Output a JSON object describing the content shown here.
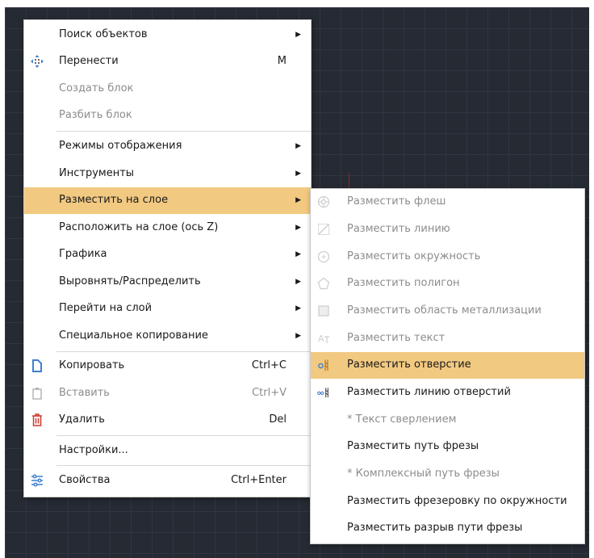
{
  "main_menu": {
    "items": [
      {
        "label": "Поиск объектов",
        "shortcut": "",
        "arrow": "▶"
      },
      {
        "label": "Перенести",
        "shortcut": "M",
        "icon": "move-icon"
      },
      {
        "label": "Создать блок",
        "shortcut": ""
      },
      {
        "label": "Разбить блок",
        "shortcut": ""
      },
      {
        "label": "Режимы отображения",
        "arrow": "▶"
      },
      {
        "label": "Инструменты",
        "arrow": "▶"
      },
      {
        "label": "Разместить на слое",
        "arrow": "▶"
      },
      {
        "label": "Расположить на слое (ось Z)",
        "arrow": "▶"
      },
      {
        "label": "Графика",
        "arrow": "▶"
      },
      {
        "label": "Выровнять/Распределить",
        "arrow": "▶"
      },
      {
        "label": "Перейти на слой",
        "arrow": "▶"
      },
      {
        "label": "Специальное копирование",
        "arrow": "▶"
      },
      {
        "label": "Копировать",
        "shortcut": "Ctrl+C",
        "icon": "copy-icon"
      },
      {
        "label": "Вставить",
        "shortcut": "Ctrl+V",
        "icon": "paste-icon"
      },
      {
        "label": "Удалить",
        "shortcut": "Del",
        "icon": "trash-icon"
      },
      {
        "label": "Настройки...",
        "shortcut": ""
      },
      {
        "label": "Свойства",
        "shortcut": "Ctrl+Enter",
        "icon": "properties-icon"
      }
    ]
  },
  "sub_menu": {
    "items": [
      {
        "label": "Разместить флеш",
        "icon": "flash-icon"
      },
      {
        "label": "Разместить линию",
        "icon": "line-icon"
      },
      {
        "label": "Разместить окружность",
        "icon": "circle-icon"
      },
      {
        "label": "Разместить полигон",
        "icon": "polygon-icon"
      },
      {
        "label": "Разместить область металлизации",
        "icon": "copper-area-icon"
      },
      {
        "label": "Разместить текст",
        "icon": "text-icon"
      },
      {
        "label": "Разместить отверстие",
        "icon": "hole-icon"
      },
      {
        "label": "Разместить линию отверстий",
        "icon": "hole-line-icon"
      },
      {
        "label": "* Текст сверлением"
      },
      {
        "label": "Разместить путь фрезы"
      },
      {
        "label": "* Комплексный путь фрезы"
      },
      {
        "label": "Разместить фрезеровку по окружности"
      },
      {
        "label": "Разместить разрыв пути фрезы"
      }
    ]
  },
  "colors": {
    "highlight": "#f2c981",
    "canvas": "#252a33",
    "icon_blue": "#3f7fd0",
    "icon_red": "#d03a2c"
  }
}
